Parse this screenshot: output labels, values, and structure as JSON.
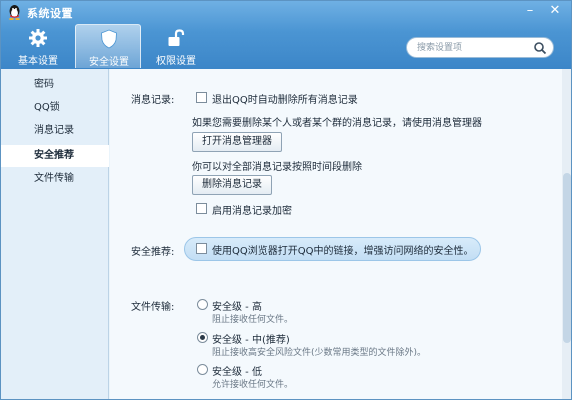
{
  "window": {
    "title": "系统设置",
    "minimize_glyph": "–",
    "close_glyph": "✕"
  },
  "tabs": [
    {
      "label": "基本设置",
      "icon": "gear-icon",
      "active": false
    },
    {
      "label": "安全设置",
      "icon": "shield-icon",
      "active": true
    },
    {
      "label": "权限设置",
      "icon": "unlock-icon",
      "active": false
    }
  ],
  "search": {
    "placeholder": "搜索设置项",
    "icon": "search-icon"
  },
  "sidebar": {
    "items": [
      {
        "label": "密码",
        "active": false
      },
      {
        "label": "QQ锁",
        "active": false
      },
      {
        "label": "消息记录",
        "active": false
      },
      {
        "label": "安全推荐",
        "active": true
      },
      {
        "label": "文件传输",
        "active": false
      }
    ]
  },
  "message_record": {
    "section_label": "消息记录:",
    "delete_on_exit": {
      "label": "退出QQ时自动删除所有消息记录",
      "checked": false
    },
    "manager_hint": "如果您需要删除某个人或者某个群的消息记录，请使用消息管理器",
    "open_manager_button": "打开消息管理器",
    "delete_hint": "你可以对全部消息记录按照时间段删除",
    "delete_button": "删除消息记录",
    "encrypt": {
      "label": "启用消息记录加密",
      "checked": false
    }
  },
  "security_recommend": {
    "section_label": "安全推荐:",
    "browser_option": {
      "label": "使用QQ浏览器打开QQ中的链接，增强访问网络的安全性。",
      "checked": false
    }
  },
  "file_transfer": {
    "section_label": "文件传输:",
    "options": [
      {
        "title": "安全级 - 高",
        "desc": "阻止接收任何文件。",
        "checked": false
      },
      {
        "title": "安全级 - 中(推荐)",
        "desc": "阻止接收高安全风险文件(少数常用类型的文件除外)。",
        "checked": true
      },
      {
        "title": "安全级 - 低",
        "desc": "允许接收任何文件。",
        "checked": false
      }
    ]
  },
  "colors": {
    "header": "#4b95d3",
    "sidebar_bg": "#e3eff9",
    "content_bg": "#f4f9fd",
    "highlight": "#c3def4"
  }
}
